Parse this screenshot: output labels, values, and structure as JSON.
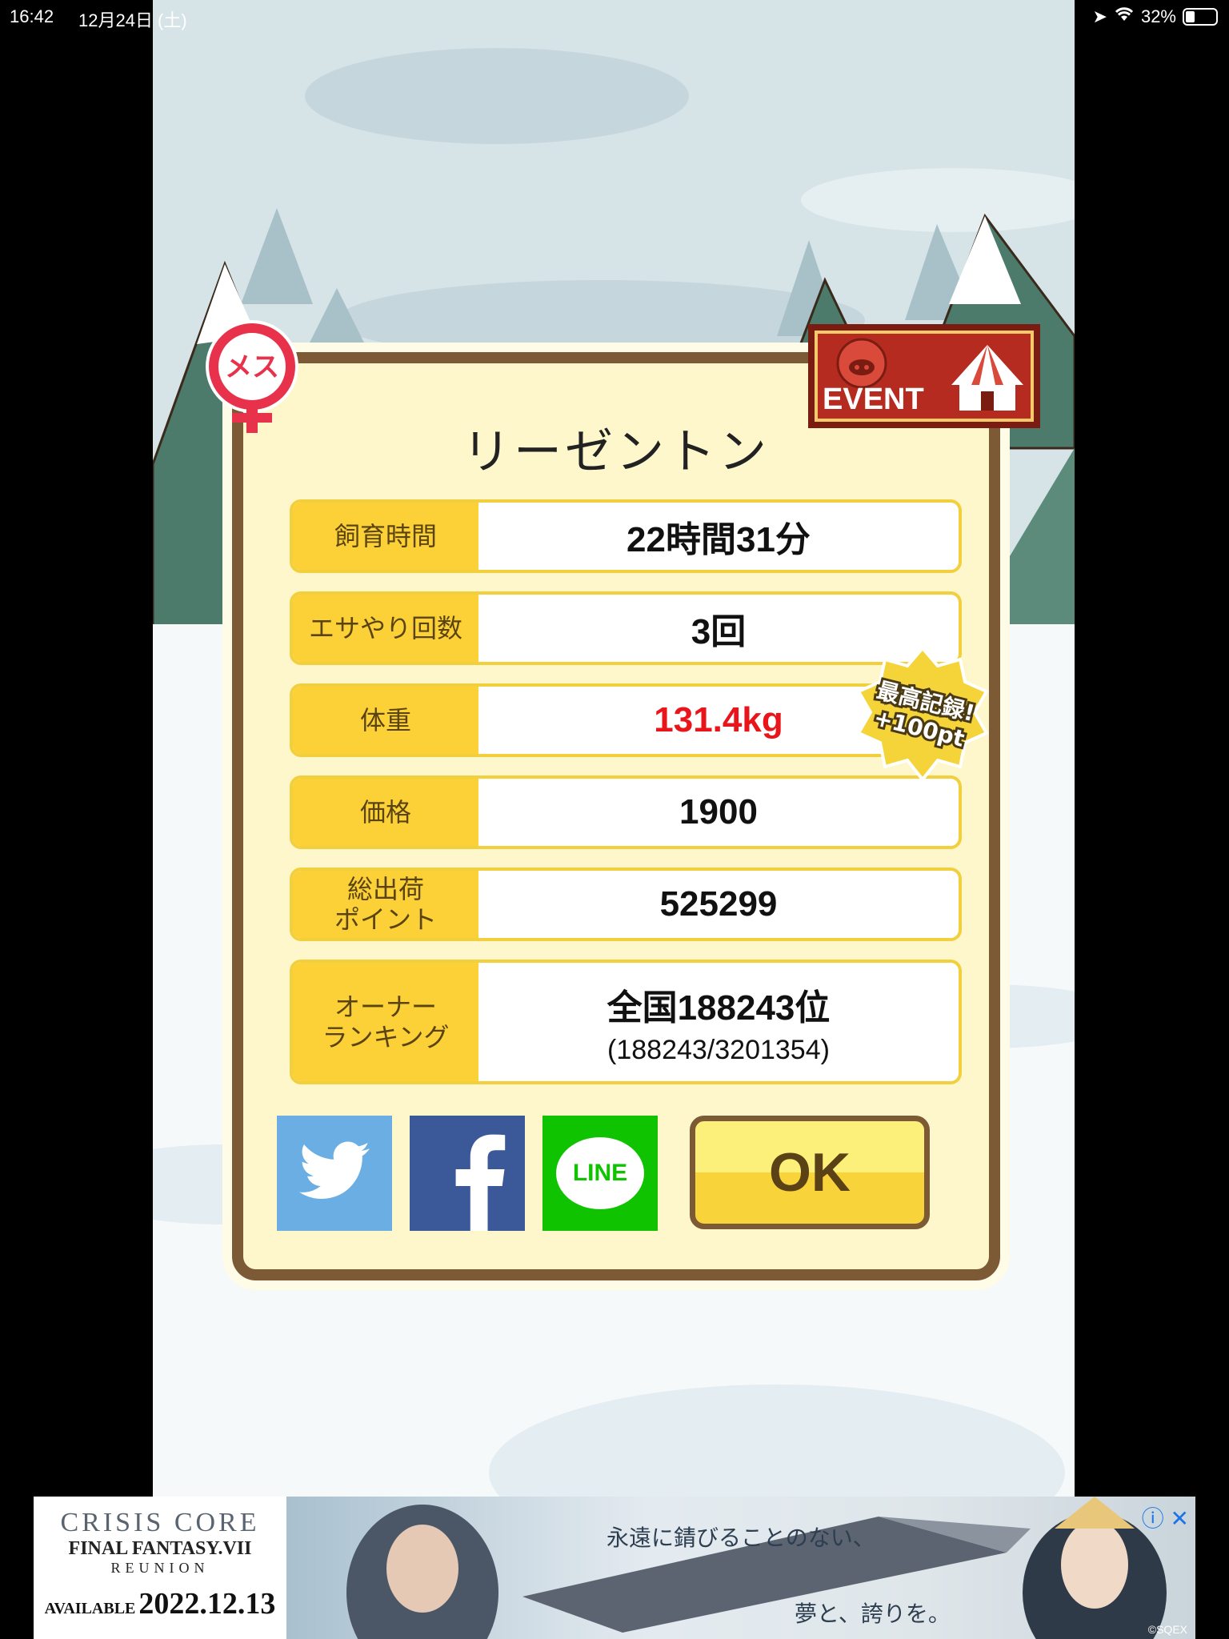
{
  "status_bar": {
    "time": "16:42",
    "date": "12月24日 (土)",
    "battery": "32%"
  },
  "pig": {
    "name": "リーゼントン",
    "gender_badge": "メス",
    "event_label": "EVENT"
  },
  "stats": [
    {
      "label": "飼育時間",
      "value": "22時間31分"
    },
    {
      "label": "エサやり回数",
      "value": "3回"
    },
    {
      "label": "体重",
      "value": "131.4kg"
    },
    {
      "label": "価格",
      "value": "1900"
    },
    {
      "label": "総出荷\nポイント",
      "value": "525299"
    },
    {
      "label": "オーナー\nランキング",
      "value": "全国188243位",
      "sub": "(188243/3201354)"
    }
  ],
  "record_badge": {
    "line1": "最高記録!",
    "line2": "+100pt"
  },
  "share": {
    "line_label": "LINE"
  },
  "ok_button": "OK",
  "ad": {
    "logo_line1": "CRISIS CORE",
    "logo_line2": "FINAL FANTASY.VII",
    "logo_line3": "REUNION",
    "available_label": "AVAILABLE",
    "available_date": "2022.12.13",
    "tagline1": "永遠に錆びることのない、",
    "tagline2": "夢と、誇りを。",
    "copyright": "©SQEX"
  },
  "colors": {
    "card_border": "#7b5a35",
    "label_bg": "#fcd137",
    "weight_red": "#e8151b",
    "twitter": "#6aaee3",
    "facebook": "#3b5999",
    "line": "#10c300"
  }
}
